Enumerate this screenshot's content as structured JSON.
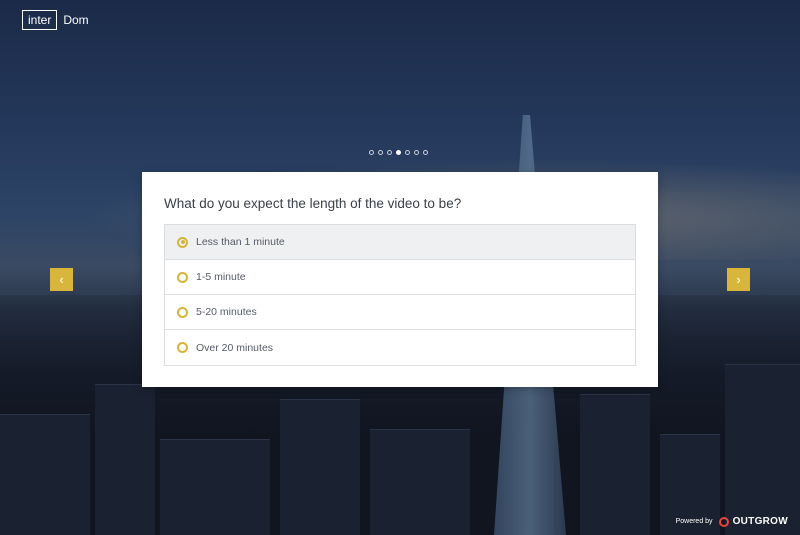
{
  "logo": {
    "box_text": "inter",
    "rest_text": "Dom"
  },
  "progress": {
    "total_steps": 7,
    "current_step": 4
  },
  "question": "What do you expect the length of the video to be?",
  "options": [
    {
      "label": "Less than 1 minute",
      "selected": true
    },
    {
      "label": "1-5 minute",
      "selected": false
    },
    {
      "label": "5-20 minutes",
      "selected": false
    },
    {
      "label": "Over 20 minutes",
      "selected": false
    }
  ],
  "nav": {
    "prev_icon": "chevron-left-icon",
    "next_icon": "chevron-right-icon",
    "prev_glyph": "‹",
    "next_glyph": "›"
  },
  "footer": {
    "powered_label": "Powered by",
    "brand": "OUTGROW",
    "brand_icon": "outgrow-logo-icon"
  },
  "colors": {
    "accent": "#d8b53b",
    "brand_red": "#e7463c"
  }
}
